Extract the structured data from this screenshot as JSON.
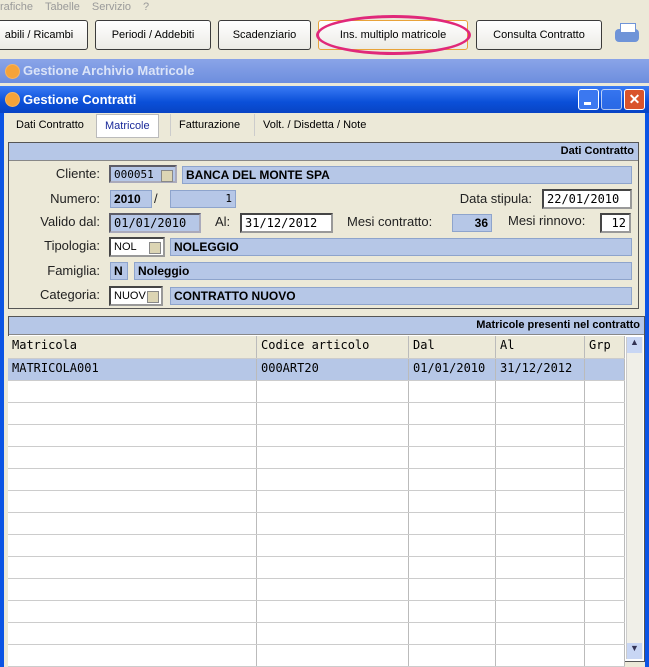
{
  "menu": [
    "rafiche",
    "Tabelle",
    "Servizio",
    "?"
  ],
  "toolbar": {
    "buttons": [
      "abili / Ricambi",
      "Periodi / Addebiti",
      "Scadenziario",
      "Ins. multiplo matricole",
      "Consulta Contratto"
    ],
    "printer_icon": "printer-icon"
  },
  "outer_window": {
    "title": "Gestione Archivio Matricole"
  },
  "window": {
    "title": "Gestione Contratti"
  },
  "tabs": [
    "Dati Contratto",
    "Matricole",
    "Fatturazione",
    "Volt. / Disdetta / Note"
  ],
  "dati": {
    "header": "Dati Contratto",
    "cliente_label": "Cliente:",
    "cliente_code": "000051",
    "cliente_name": "BANCA DEL MONTE SPA",
    "numero_label": "Numero:",
    "numero_anno": "2010",
    "numero_sep": "/",
    "numero_num": "1",
    "data_stipula_label": "Data stipula:",
    "data_stipula": "22/01/2010",
    "valido_label": "Valido dal:",
    "valido_dal": "01/01/2010",
    "al_label": "Al:",
    "al": "31/12/2012",
    "mesi_contratto_label": "Mesi contratto:",
    "mesi_contratto": "36",
    "mesi_rinnovo_label": "Mesi rinnovo:",
    "mesi_rinnovo": "12",
    "tipologia_label": "Tipologia:",
    "tipologia_code": "NOL",
    "tipologia_name": "NOLEGGIO",
    "famiglia_label": "Famiglia:",
    "famiglia_code": "N",
    "famiglia_name": "Noleggio",
    "categoria_label": "Categoria:",
    "categoria_code": "NUOV",
    "categoria_name": "CONTRATTO NUOVO"
  },
  "grid": {
    "header": "Matricole presenti nel contratto",
    "columns": [
      "Matricola",
      "Codice articolo",
      "Dal",
      "Al",
      "Grp"
    ],
    "rows": [
      [
        "MATRICOLA001",
        "000ART20",
        "01/01/2010",
        "31/12/2012",
        ""
      ]
    ]
  }
}
